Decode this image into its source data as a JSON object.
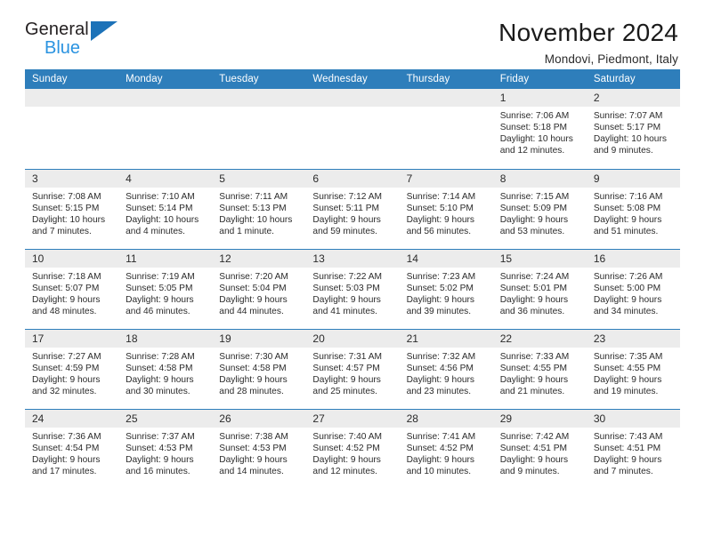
{
  "logo": {
    "word_top": "General",
    "word_bottom": "Blue",
    "triangle_color": "#1c72b8",
    "bottom_color": "#2a93e0"
  },
  "header": {
    "title": "November 2024",
    "subtitle": "Mondovi, Piedmont, Italy"
  },
  "theme": {
    "header_blue": "#2e7ebb",
    "daynum_gray": "#ececec",
    "text": "#2b2b2b"
  },
  "weekdays": [
    "Sunday",
    "Monday",
    "Tuesday",
    "Wednesday",
    "Thursday",
    "Friday",
    "Saturday"
  ],
  "weeks": [
    [
      {
        "day": "",
        "sunrise": "",
        "sunset": "",
        "daylight": ""
      },
      {
        "day": "",
        "sunrise": "",
        "sunset": "",
        "daylight": ""
      },
      {
        "day": "",
        "sunrise": "",
        "sunset": "",
        "daylight": ""
      },
      {
        "day": "",
        "sunrise": "",
        "sunset": "",
        "daylight": ""
      },
      {
        "day": "",
        "sunrise": "",
        "sunset": "",
        "daylight": ""
      },
      {
        "day": "1",
        "sunrise": "Sunrise: 7:06 AM",
        "sunset": "Sunset: 5:18 PM",
        "daylight": "Daylight: 10 hours and 12 minutes."
      },
      {
        "day": "2",
        "sunrise": "Sunrise: 7:07 AM",
        "sunset": "Sunset: 5:17 PM",
        "daylight": "Daylight: 10 hours and 9 minutes."
      }
    ],
    [
      {
        "day": "3",
        "sunrise": "Sunrise: 7:08 AM",
        "sunset": "Sunset: 5:15 PM",
        "daylight": "Daylight: 10 hours and 7 minutes."
      },
      {
        "day": "4",
        "sunrise": "Sunrise: 7:10 AM",
        "sunset": "Sunset: 5:14 PM",
        "daylight": "Daylight: 10 hours and 4 minutes."
      },
      {
        "day": "5",
        "sunrise": "Sunrise: 7:11 AM",
        "sunset": "Sunset: 5:13 PM",
        "daylight": "Daylight: 10 hours and 1 minute."
      },
      {
        "day": "6",
        "sunrise": "Sunrise: 7:12 AM",
        "sunset": "Sunset: 5:11 PM",
        "daylight": "Daylight: 9 hours and 59 minutes."
      },
      {
        "day": "7",
        "sunrise": "Sunrise: 7:14 AM",
        "sunset": "Sunset: 5:10 PM",
        "daylight": "Daylight: 9 hours and 56 minutes."
      },
      {
        "day": "8",
        "sunrise": "Sunrise: 7:15 AM",
        "sunset": "Sunset: 5:09 PM",
        "daylight": "Daylight: 9 hours and 53 minutes."
      },
      {
        "day": "9",
        "sunrise": "Sunrise: 7:16 AM",
        "sunset": "Sunset: 5:08 PM",
        "daylight": "Daylight: 9 hours and 51 minutes."
      }
    ],
    [
      {
        "day": "10",
        "sunrise": "Sunrise: 7:18 AM",
        "sunset": "Sunset: 5:07 PM",
        "daylight": "Daylight: 9 hours and 48 minutes."
      },
      {
        "day": "11",
        "sunrise": "Sunrise: 7:19 AM",
        "sunset": "Sunset: 5:05 PM",
        "daylight": "Daylight: 9 hours and 46 minutes."
      },
      {
        "day": "12",
        "sunrise": "Sunrise: 7:20 AM",
        "sunset": "Sunset: 5:04 PM",
        "daylight": "Daylight: 9 hours and 44 minutes."
      },
      {
        "day": "13",
        "sunrise": "Sunrise: 7:22 AM",
        "sunset": "Sunset: 5:03 PM",
        "daylight": "Daylight: 9 hours and 41 minutes."
      },
      {
        "day": "14",
        "sunrise": "Sunrise: 7:23 AM",
        "sunset": "Sunset: 5:02 PM",
        "daylight": "Daylight: 9 hours and 39 minutes."
      },
      {
        "day": "15",
        "sunrise": "Sunrise: 7:24 AM",
        "sunset": "Sunset: 5:01 PM",
        "daylight": "Daylight: 9 hours and 36 minutes."
      },
      {
        "day": "16",
        "sunrise": "Sunrise: 7:26 AM",
        "sunset": "Sunset: 5:00 PM",
        "daylight": "Daylight: 9 hours and 34 minutes."
      }
    ],
    [
      {
        "day": "17",
        "sunrise": "Sunrise: 7:27 AM",
        "sunset": "Sunset: 4:59 PM",
        "daylight": "Daylight: 9 hours and 32 minutes."
      },
      {
        "day": "18",
        "sunrise": "Sunrise: 7:28 AM",
        "sunset": "Sunset: 4:58 PM",
        "daylight": "Daylight: 9 hours and 30 minutes."
      },
      {
        "day": "19",
        "sunrise": "Sunrise: 7:30 AM",
        "sunset": "Sunset: 4:58 PM",
        "daylight": "Daylight: 9 hours and 28 minutes."
      },
      {
        "day": "20",
        "sunrise": "Sunrise: 7:31 AM",
        "sunset": "Sunset: 4:57 PM",
        "daylight": "Daylight: 9 hours and 25 minutes."
      },
      {
        "day": "21",
        "sunrise": "Sunrise: 7:32 AM",
        "sunset": "Sunset: 4:56 PM",
        "daylight": "Daylight: 9 hours and 23 minutes."
      },
      {
        "day": "22",
        "sunrise": "Sunrise: 7:33 AM",
        "sunset": "Sunset: 4:55 PM",
        "daylight": "Daylight: 9 hours and 21 minutes."
      },
      {
        "day": "23",
        "sunrise": "Sunrise: 7:35 AM",
        "sunset": "Sunset: 4:55 PM",
        "daylight": "Daylight: 9 hours and 19 minutes."
      }
    ],
    [
      {
        "day": "24",
        "sunrise": "Sunrise: 7:36 AM",
        "sunset": "Sunset: 4:54 PM",
        "daylight": "Daylight: 9 hours and 17 minutes."
      },
      {
        "day": "25",
        "sunrise": "Sunrise: 7:37 AM",
        "sunset": "Sunset: 4:53 PM",
        "daylight": "Daylight: 9 hours and 16 minutes."
      },
      {
        "day": "26",
        "sunrise": "Sunrise: 7:38 AM",
        "sunset": "Sunset: 4:53 PM",
        "daylight": "Daylight: 9 hours and 14 minutes."
      },
      {
        "day": "27",
        "sunrise": "Sunrise: 7:40 AM",
        "sunset": "Sunset: 4:52 PM",
        "daylight": "Daylight: 9 hours and 12 minutes."
      },
      {
        "day": "28",
        "sunrise": "Sunrise: 7:41 AM",
        "sunset": "Sunset: 4:52 PM",
        "daylight": "Daylight: 9 hours and 10 minutes."
      },
      {
        "day": "29",
        "sunrise": "Sunrise: 7:42 AM",
        "sunset": "Sunset: 4:51 PM",
        "daylight": "Daylight: 9 hours and 9 minutes."
      },
      {
        "day": "30",
        "sunrise": "Sunrise: 7:43 AM",
        "sunset": "Sunset: 4:51 PM",
        "daylight": "Daylight: 9 hours and 7 minutes."
      }
    ]
  ]
}
